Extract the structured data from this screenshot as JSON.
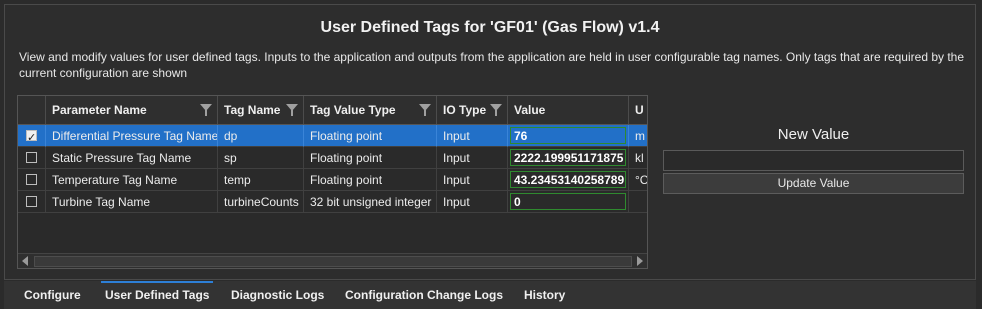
{
  "title": "User Defined Tags for 'GF01' (Gas Flow) v1.4",
  "description": "View and modify values for user defined tags. Inputs to the application and outputs from the application are held in user configurable tag names. Only tags that are required by the current configuration are shown",
  "grid": {
    "columns": [
      "Parameter Name",
      "Tag Name",
      "Tag Value Type",
      "IO Type",
      "Value",
      "U"
    ],
    "rows": [
      {
        "param": "Differential Pressure Tag Name",
        "tag": "dp",
        "type": "Floating point",
        "io": "Input",
        "value": "76",
        "unit": "m",
        "checked": true,
        "selected": true
      },
      {
        "param": "Static Pressure Tag Name",
        "tag": "sp",
        "type": "Floating point",
        "io": "Input",
        "value": "2222.199951171875",
        "unit": "kl",
        "checked": false,
        "selected": false
      },
      {
        "param": "Temperature Tag Name",
        "tag": "temp",
        "type": "Floating point",
        "io": "Input",
        "value": "43.23453140258789",
        "unit": "°C",
        "checked": false,
        "selected": false
      },
      {
        "param": "Turbine Tag Name",
        "tag": "turbineCounts",
        "type": "32 bit unsigned integer",
        "io": "Input",
        "value": "0",
        "unit": "",
        "checked": false,
        "selected": false
      }
    ]
  },
  "new_value": {
    "label": "New Value",
    "input_value": "",
    "button_label": "Update Value"
  },
  "tabs": [
    {
      "label": "Configure",
      "active": false
    },
    {
      "label": "User Defined Tags",
      "active": true
    },
    {
      "label": "Diagnostic Logs",
      "active": false
    },
    {
      "label": "Configuration Change Logs",
      "active": false
    },
    {
      "label": "History",
      "active": false
    }
  ],
  "colors": {
    "selection": "#2270c8",
    "value_border": "#2f8a2f",
    "active_tab": "#2d7fd6",
    "background": "#2b2b2b"
  }
}
